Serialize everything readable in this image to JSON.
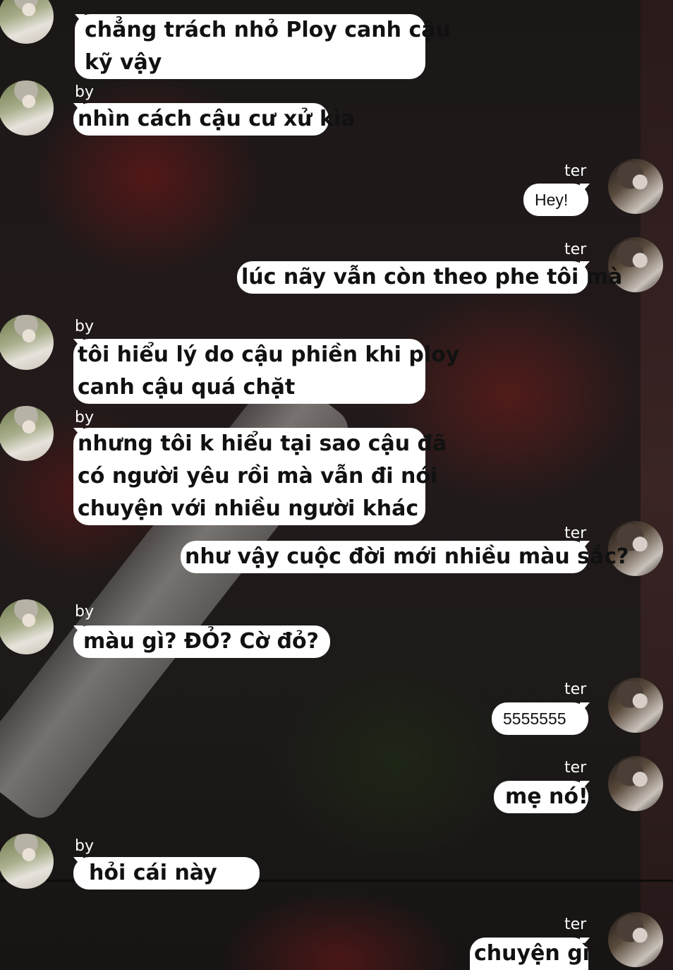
{
  "names": {
    "left": "by",
    "right": "ter"
  },
  "messages": [
    {
      "sender": "by",
      "lines": [
        "chẳng trách nhỏ Ploy canh cậu",
        "kỹ vậy"
      ],
      "style": "bold"
    },
    {
      "sender": "by",
      "lines": [
        "nhìn cách cậu cư xử kìa"
      ],
      "style": "bold"
    },
    {
      "sender": "ter",
      "lines": [
        "Hey!"
      ],
      "style": "regular"
    },
    {
      "sender": "ter",
      "lines": [
        "lúc nãy vẫn còn theo phe tôi mà"
      ],
      "style": "bold"
    },
    {
      "sender": "by",
      "lines": [
        "tôi hiểu lý do cậu phiền khi ploy",
        "canh cậu quá chặt"
      ],
      "style": "bold"
    },
    {
      "sender": "by",
      "lines": [
        "nhưng tôi k hiểu tại sao cậu đã",
        "có người yêu rồi mà vẫn đi nói",
        "chuyện với nhiều người khác"
      ],
      "style": "bold"
    },
    {
      "sender": "ter",
      "lines": [
        "như vậy cuộc đời mới nhiều màu sắc?"
      ],
      "style": "bold"
    },
    {
      "sender": "by",
      "lines": [
        "màu gì? ĐỎ? Cờ đỏ?"
      ],
      "style": "bold"
    },
    {
      "sender": "ter",
      "lines": [
        "5555555"
      ],
      "style": "regular"
    },
    {
      "sender": "ter",
      "lines": [
        "mẹ nó!"
      ],
      "style": "bold"
    },
    {
      "sender": "by",
      "lines": [
        "hỏi cái này"
      ],
      "style": "bold"
    },
    {
      "sender": "ter",
      "lines": [
        "chuyện gì"
      ],
      "style": "bold"
    }
  ],
  "colors": {
    "bubble": "#ffffff",
    "text": "#111111",
    "name": "#ffffff",
    "background": "#161414"
  }
}
